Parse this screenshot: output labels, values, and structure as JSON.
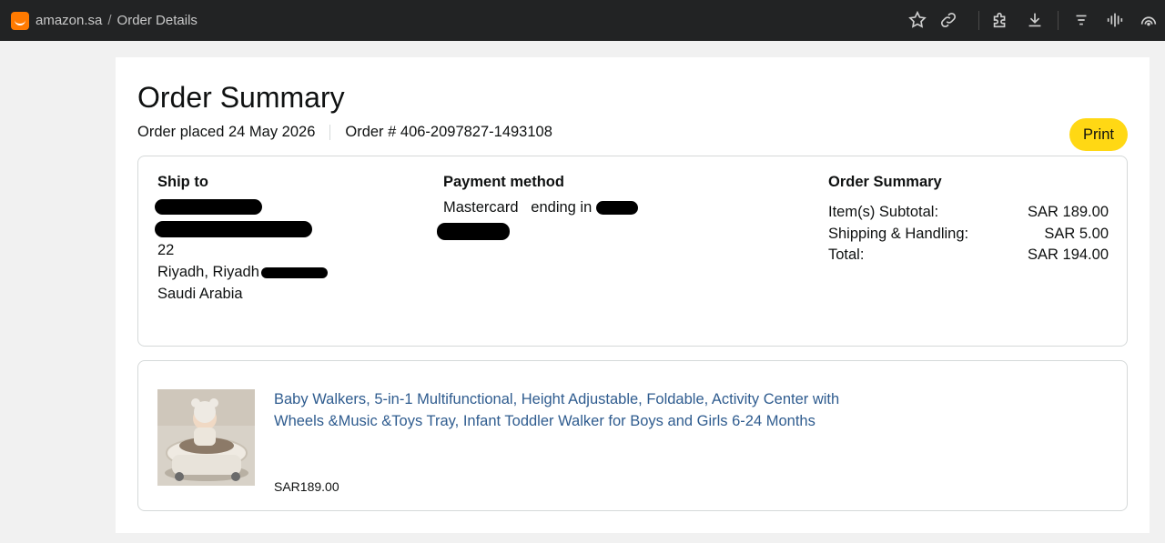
{
  "browser": {
    "host": "amazon.sa",
    "separator": "/",
    "page": "Order Details",
    "icons": [
      "star-icon",
      "link-icon",
      "extensions-icon",
      "download-icon",
      "menu-icon",
      "audio-wave-icon",
      "app-icon"
    ]
  },
  "order": {
    "title": "Order Summary",
    "placed_label": "Order placed 24 May 2026",
    "number_label": "Order # 406-2097827-1493108",
    "print_label": "Print"
  },
  "ship_to": {
    "heading": "Ship to",
    "street": "22",
    "city": "Riyadh, Riyadh",
    "country": "Saudi Arabia"
  },
  "payment": {
    "heading": "Payment method",
    "card": "Mastercard",
    "ending": "ending in"
  },
  "summary": {
    "heading": "Order Summary",
    "rows": [
      {
        "label": "Item(s) Subtotal:",
        "value": "SAR 189.00"
      },
      {
        "label": "Shipping & Handling:",
        "value": "SAR 5.00"
      },
      {
        "label": "Total:",
        "value": "SAR 194.00"
      }
    ]
  },
  "item": {
    "title": "Baby Walkers, 5-in-1 Multifunctional, Height Adjustable, Foldable, Activity Center with Wheels &Music &Toys Tray, Infant Toddler Walker for Boys and Girls 6-24 Months",
    "price": "SAR189.00"
  },
  "colors": {
    "accent_button": "#ffd814",
    "link": "#2f5c8f",
    "favicon": "#ff7a00",
    "browser_bar": "#222324"
  }
}
